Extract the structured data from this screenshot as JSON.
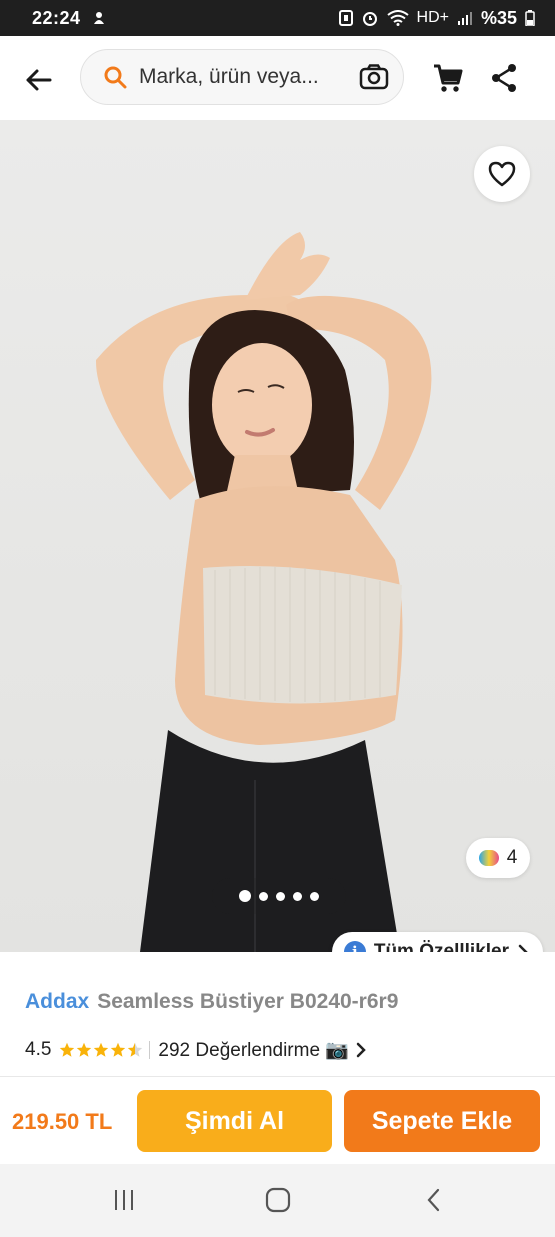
{
  "status_bar": {
    "time": "22:24",
    "battery": "%35",
    "network": "HD+"
  },
  "header": {
    "search_placeholder": "Marka, ürün veya..."
  },
  "image": {
    "color_count": "4",
    "slide_count": 5,
    "active_slide": 1,
    "specs_label": "Tüm Özelllikler"
  },
  "product": {
    "brand": "Addax",
    "name": "Seamless Büstiyer B0240-r6r9",
    "rating": "4.5",
    "rating_value": 4.5,
    "reviews": "292 Değerlendirme 📷"
  },
  "purchase": {
    "price": "219.50 TL",
    "buy_now_label": "Şimdi Al",
    "add_to_cart_label": "Sepete Ekle"
  },
  "colors": {
    "orange": "#f27a1a",
    "yellow": "#f9ad1b",
    "brand_blue": "#4a8fdb"
  }
}
